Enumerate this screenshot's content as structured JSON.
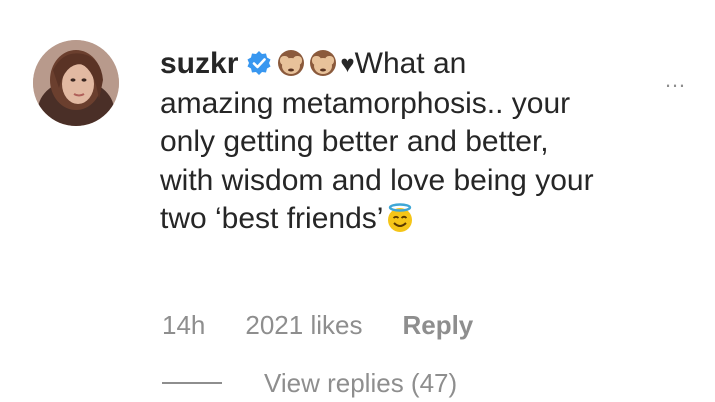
{
  "comment": {
    "username": "suzkr",
    "text_line1": "What an",
    "text_line2": "amazing metamorphosis.. your",
    "text_line3": "only getting better and better,",
    "text_line4": "with wisdom and love being your",
    "text_line5": "two ‘best friends’",
    "heart": "♥",
    "more_label": "…",
    "time": "14h",
    "likes": "2021 likes",
    "reply_label": "Reply",
    "view_replies": "View replies (47)"
  },
  "colors": {
    "text": "#262626",
    "secondary": "#8e8e8e",
    "verified": "#3897f0"
  },
  "icons": {
    "verified": "verified-badge-icon",
    "emoji1": "see-no-evil-monkey-emoji",
    "emoji2": "see-no-evil-monkey-emoji",
    "emoji3": "smiling-face-with-halo-emoji"
  }
}
